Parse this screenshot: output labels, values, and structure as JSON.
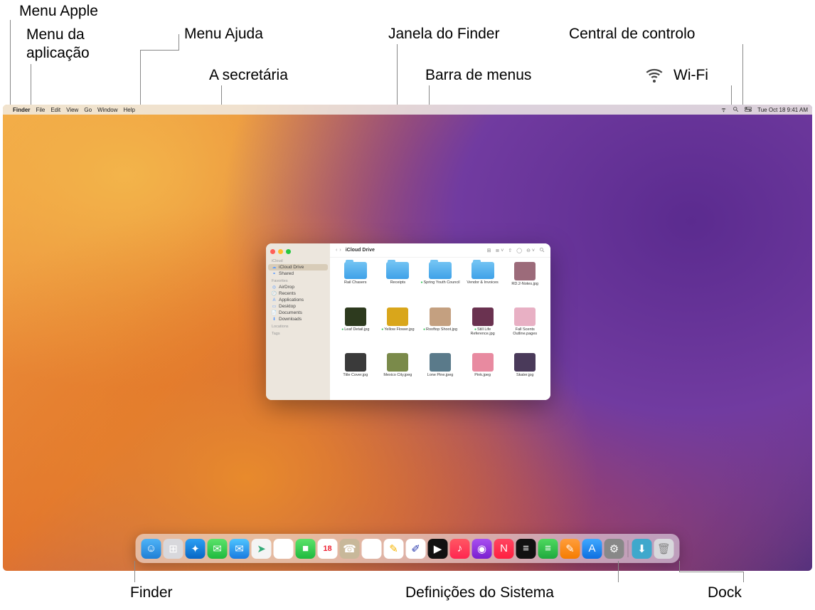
{
  "callouts": {
    "menu_apple": "Menu Apple",
    "menu_app": "Menu da\naplicação",
    "menu_help": "Menu Ajuda",
    "desktop": "A secretária",
    "finder_window": "Janela do Finder",
    "menubar": "Barra de menus",
    "control_center": "Central de controlo",
    "wifi": "Wi-Fi",
    "finder": "Finder",
    "system_settings": "Definições do Sistema",
    "dock": "Dock"
  },
  "menubar": {
    "app": "Finder",
    "items": [
      "File",
      "Edit",
      "View",
      "Go",
      "Window",
      "Help"
    ],
    "datetime": "Tue Oct 18  9:41 AM"
  },
  "finder": {
    "title": "iCloud Drive",
    "sidebar": {
      "sections": [
        {
          "label": "iCloud",
          "items": [
            {
              "label": "iCloud Drive",
              "icon": "cloud",
              "active": true
            },
            {
              "label": "Shared",
              "icon": "shared"
            }
          ]
        },
        {
          "label": "Favorites",
          "items": [
            {
              "label": "AirDrop",
              "icon": "airdrop"
            },
            {
              "label": "Recents",
              "icon": "clock"
            },
            {
              "label": "Applications",
              "icon": "apps"
            },
            {
              "label": "Desktop",
              "icon": "desktop"
            },
            {
              "label": "Documents",
              "icon": "doc"
            },
            {
              "label": "Downloads",
              "icon": "down"
            }
          ]
        },
        {
          "label": "Locations",
          "items": []
        },
        {
          "label": "Tags",
          "items": []
        }
      ]
    },
    "items": [
      {
        "name": "Rail Chasers",
        "type": "folder"
      },
      {
        "name": "Receipts",
        "type": "folder"
      },
      {
        "name": "Spring Youth Council",
        "type": "folder",
        "dot": true
      },
      {
        "name": "Vendor & Invoices",
        "type": "folder"
      },
      {
        "name": "RD.2-Notes.jpg",
        "type": "image",
        "color": "#9c6b7a"
      },
      {
        "name": "Leaf Detail.jpg",
        "type": "image",
        "color": "#2d3a1e",
        "dot": true
      },
      {
        "name": "Yellow Flower.jpg",
        "type": "image",
        "color": "#d9a61b",
        "dot": true
      },
      {
        "name": "Rooftop Shoot.jpg",
        "type": "image",
        "color": "#c4a080",
        "dot": true
      },
      {
        "name": "Still Life Reference.jpg",
        "type": "image",
        "color": "#6a3250",
        "dot": true
      },
      {
        "name": "Fall Scents Outline.pages",
        "type": "image",
        "color": "#e8b0c4"
      },
      {
        "name": "Title Cover.jpg",
        "type": "image",
        "color": "#3a3a3a"
      },
      {
        "name": "Mexico City.jpeg",
        "type": "image",
        "color": "#7a8a4a"
      },
      {
        "name": "Lone Pine.jpeg",
        "type": "image",
        "color": "#5a7a8a"
      },
      {
        "name": "Pink.jpeg",
        "type": "image",
        "color": "#e88aa0"
      },
      {
        "name": "Skater.jpg",
        "type": "image",
        "color": "#4a3a5a"
      }
    ]
  },
  "dock": {
    "apps": [
      {
        "name": "Finder",
        "cls": "di-finder",
        "glyph": "☺"
      },
      {
        "name": "Launchpad",
        "cls": "di-launchpad",
        "glyph": "⊞"
      },
      {
        "name": "Safari",
        "cls": "di-safari",
        "glyph": "✦"
      },
      {
        "name": "Messages",
        "cls": "di-messages",
        "glyph": "✉"
      },
      {
        "name": "Mail",
        "cls": "di-mail",
        "glyph": "✉"
      },
      {
        "name": "Maps",
        "cls": "di-maps",
        "glyph": "➤"
      },
      {
        "name": "Photos",
        "cls": "di-photos",
        "glyph": "❀"
      },
      {
        "name": "FaceTime",
        "cls": "di-facetime",
        "glyph": "■"
      },
      {
        "name": "Calendar",
        "cls": "di-calendar",
        "glyph": "18"
      },
      {
        "name": "Contacts",
        "cls": "di-contacts",
        "glyph": "☎"
      },
      {
        "name": "Reminders",
        "cls": "di-reminders",
        "glyph": "☑"
      },
      {
        "name": "Notes",
        "cls": "di-notes",
        "glyph": "✎"
      },
      {
        "name": "Freeform",
        "cls": "di-freeform",
        "glyph": "✐"
      },
      {
        "name": "TV",
        "cls": "di-tv",
        "glyph": "▶"
      },
      {
        "name": "Music",
        "cls": "di-music",
        "glyph": "♪"
      },
      {
        "name": "Podcasts",
        "cls": "di-podcasts",
        "glyph": "◉"
      },
      {
        "name": "News",
        "cls": "di-news",
        "glyph": "N"
      },
      {
        "name": "Stocks",
        "cls": "di-stocks",
        "glyph": "≡"
      },
      {
        "name": "Numbers",
        "cls": "di-numbers",
        "glyph": "≡"
      },
      {
        "name": "Pages",
        "cls": "di-pages",
        "glyph": "✎"
      },
      {
        "name": "App Store",
        "cls": "di-appstore",
        "glyph": "A"
      },
      {
        "name": "System Settings",
        "cls": "di-settings",
        "glyph": "⚙"
      }
    ],
    "right": [
      {
        "name": "Downloads",
        "cls": "di-downloads",
        "glyph": "⬇"
      },
      {
        "name": "Trash",
        "cls": "di-trash",
        "glyph": "🗑"
      }
    ]
  }
}
